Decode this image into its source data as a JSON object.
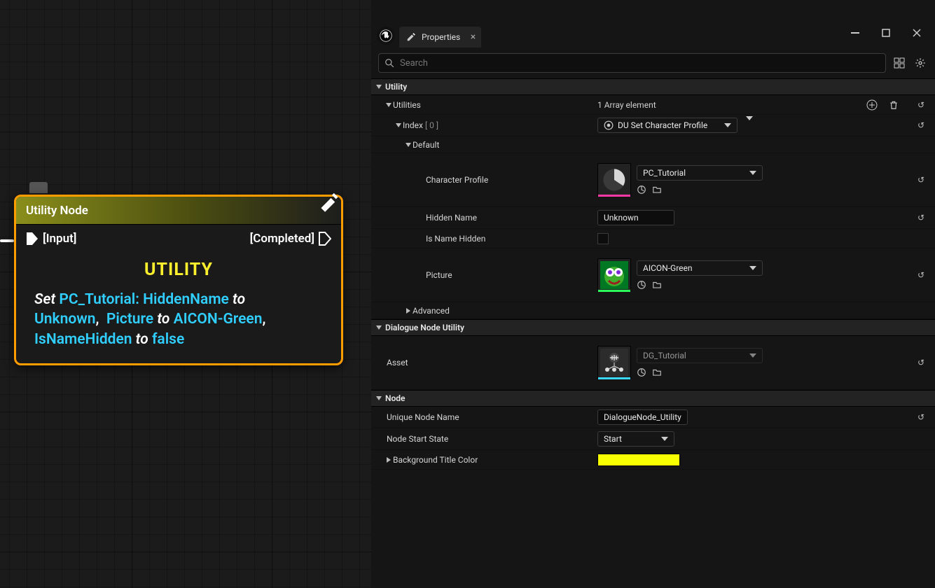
{
  "graph": {
    "node_title": "Utility Node",
    "pin_in": "[Input]",
    "pin_out": "[Completed]",
    "heading": "UTILITY",
    "desc": {
      "set": "Set ",
      "ref1": "PC_Tutorial: HiddenName",
      "to1": " to ",
      "val1": "Unknown",
      "ref2": "Picture",
      "to2": " to ",
      "val2": "AICON-Green",
      "ref3": "IsNameHidden",
      "to3": " to ",
      "val3": "false"
    }
  },
  "panel": {
    "tab": "Properties",
    "search_placeholder": "Search",
    "sections": {
      "utility": "Utility",
      "utilities": "Utilities",
      "utilities_count": "1 Array element",
      "index_label": "Index",
      "index_value": "[ 0 ]",
      "index_type": "DU Set Character Profile",
      "default": "Default",
      "char_profile": "Character Profile",
      "char_profile_val": "PC_Tutorial",
      "hidden_name": "Hidden Name",
      "hidden_name_val": "Unknown",
      "is_name_hidden": "Is Name Hidden",
      "picture": "Picture",
      "picture_val": "AICON-Green",
      "advanced": "Advanced",
      "dnu": "Dialogue Node Utility",
      "asset": "Asset",
      "asset_val": "DG_Tutorial",
      "node": "Node",
      "unique": "Unique Node Name",
      "unique_val": "DialogueNode_Utility",
      "start_state": "Node Start State",
      "start_state_val": "Start",
      "bg_color": "Background Title Color"
    }
  }
}
